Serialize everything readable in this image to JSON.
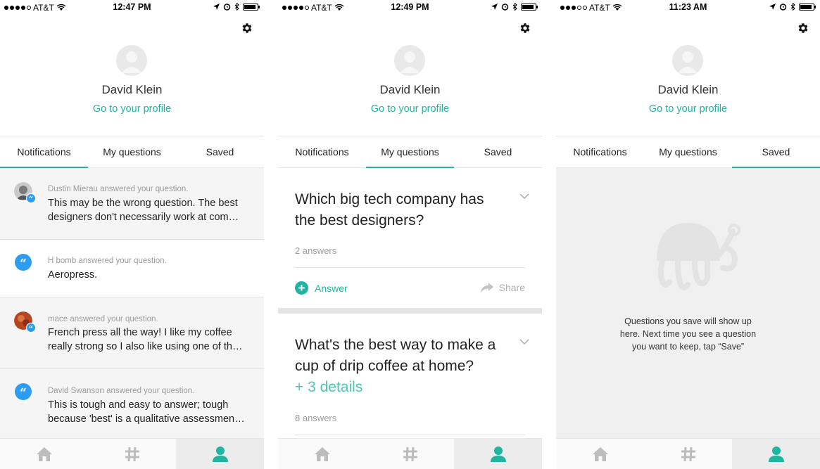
{
  "screens": [
    {
      "status": {
        "carrier": "AT&T",
        "time": "12:47 PM",
        "signal_filled": 4
      },
      "profile": {
        "name": "David Klein",
        "link": "Go to your profile"
      },
      "tabs": [
        "Notifications",
        "My questions",
        "Saved"
      ],
      "active_tab": 0,
      "notifications": [
        {
          "who": "Dustin Mierau answered your question.",
          "lines": [
            "This may be the wrong question. The best",
            "designers don't necessarily work at com…"
          ]
        },
        {
          "who": "H bomb answered your question.",
          "lines": [
            "Aeropress."
          ]
        },
        {
          "who": "mace answered your question.",
          "lines": [
            "French press all the way! I like my coffee",
            "really strong so I also like using one of th…"
          ]
        },
        {
          "who": "David Swanson answered your question.",
          "lines": [
            "This is tough and easy to answer; tough",
            "because 'best' is a qualitative assessmen…"
          ]
        }
      ]
    },
    {
      "status": {
        "carrier": "AT&T",
        "time": "12:49 PM",
        "signal_filled": 4
      },
      "profile": {
        "name": "David Klein",
        "link": "Go to your profile"
      },
      "tabs": [
        "Notifications",
        "My questions",
        "Saved"
      ],
      "active_tab": 1,
      "questions": [
        {
          "lines": [
            "Which big tech company has",
            "the best designers?"
          ],
          "answers": "2 answers",
          "answer_label": "Answer",
          "share_label": "Share"
        },
        {
          "lines": [
            "What's the best way to make a",
            "cup of drip coffee at home?"
          ],
          "details": "+ 3 details",
          "answers": "8 answers"
        }
      ]
    },
    {
      "status": {
        "carrier": "AT&T",
        "time": "11:23 AM",
        "signal_filled": 3
      },
      "profile": {
        "name": "David Klein",
        "link": "Go to your profile"
      },
      "tabs": [
        "Notifications",
        "My questions",
        "Saved"
      ],
      "active_tab": 2,
      "empty_lines": [
        "Questions you save will show up",
        "here. Next time you see a question",
        "you want to keep, tap “Save”"
      ]
    }
  ],
  "nav_icons": [
    "home-icon",
    "hashtag-icon",
    "person-icon"
  ],
  "colors": {
    "accent": "#1fb5a0",
    "quote_badge": "#2d9cf3",
    "details": "#4fc7b5"
  }
}
